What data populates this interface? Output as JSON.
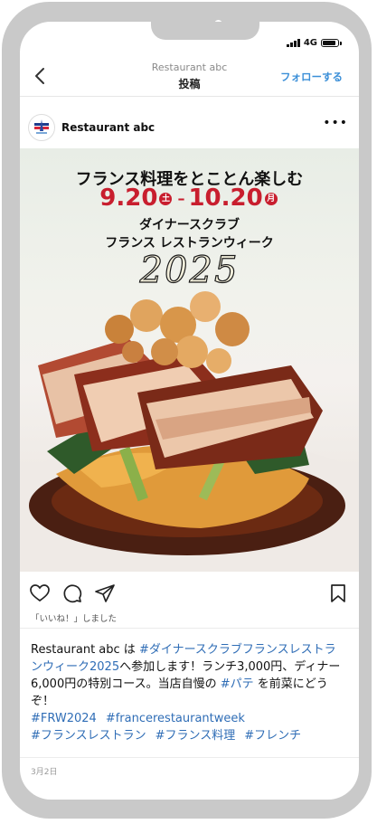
{
  "header": {
    "subtitle": "Restaurant abc",
    "title": "投稿",
    "follow_label": "フォローする"
  },
  "status_bar": {
    "network": "4G"
  },
  "post": {
    "username": "Restaurant abc",
    "overlay": {
      "title": "フランス料理をとことん楽しむ",
      "date_start": "9.20",
      "start_day": "土",
      "dash": "–",
      "date_end": "10.20",
      "end_day": "月",
      "line1": "ダイナースクラブ",
      "line2": "フランス レストランウィーク",
      "year": "2025"
    },
    "likes_text": "「いいね！」しました",
    "caption": {
      "username": "Restaurant abc",
      "text1": " は ",
      "hashtag1": "#ダイナースクラブフランスレストランウィーク2025",
      "text2": "へ参加します！ランチ3,000円、ディナー6,000円の特別コース。当店自慢の ",
      "hashtag2": "#パテ",
      "text3": " を前菜にどうぞ！",
      "tags_row1": [
        "#FRW2024",
        "#francerestaurantweek"
      ],
      "tags_row2": [
        "#フランスレストラン",
        "#フランス料理",
        "#フレンチ"
      ]
    },
    "date": "3月2日"
  },
  "colors": {
    "accent_blue": "#3b8fd8",
    "hashtag_blue": "#2f6db6",
    "date_red": "#c81e2e",
    "phone_frame": "#c9c9c9"
  },
  "icons": [
    "back-chevron-icon",
    "more-dots-icon",
    "heart-icon",
    "comment-icon",
    "share-icon",
    "bookmark-icon",
    "signal-icon",
    "battery-icon"
  ]
}
